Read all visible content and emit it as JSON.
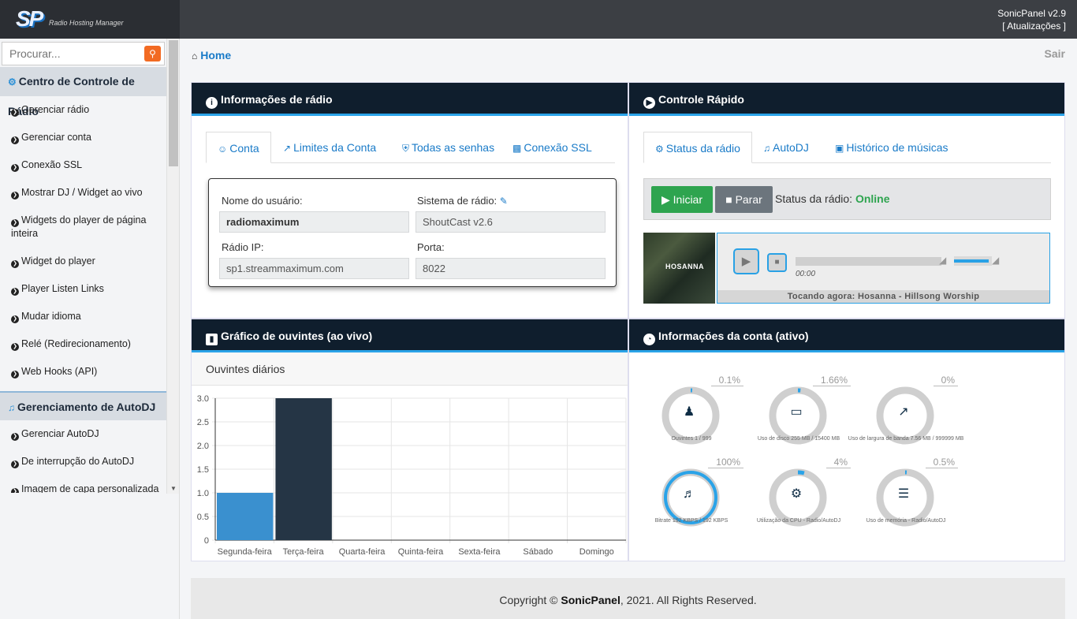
{
  "brand": {
    "logo": "SP",
    "subtitle": "Radio Hosting Manager"
  },
  "header": {
    "version": "SonicPanel v2.9",
    "updates": "[ Atualizações ]"
  },
  "search": {
    "placeholder": "Procurar..."
  },
  "sidebar": {
    "section1": "Centro de Controle de Rádio",
    "items1": [
      "Gerenciar rádio",
      "Gerenciar conta",
      "Conexão SSL",
      "Mostrar DJ / Widget ao vivo",
      "Widgets do player de página inteira",
      "Widget do player",
      "Player Listen Links",
      "Mudar idioma",
      "Relé (Redirecionamento)",
      "Web Hooks (API)"
    ],
    "section2": "Gerenciamento de AutoDJ",
    "items2": [
      "Gerenciar AutoDJ",
      "De interrupção do AutoDJ",
      "Imagem de capa personalizada"
    ]
  },
  "breadcrumb": {
    "home": "Home"
  },
  "logout": "Sair",
  "radio_info": {
    "title": "Informações de rádio",
    "tabs": [
      "Conta",
      "Limites da Conta",
      "Todas as senhas",
      "Conexão SSL"
    ],
    "username_label": "Nome do usuário:",
    "username": "radiomaximum",
    "system_label": "Sistema de rádio:",
    "system": "ShoutCast v2.6",
    "ip_label": "Rádio IP:",
    "ip": "sp1.streammaximum.com",
    "port_label": "Porta:",
    "port": "8022"
  },
  "quick_control": {
    "title": "Controle Rápido",
    "tabs": [
      "Status da rádio",
      "AutoDJ",
      "Histórico de músicas"
    ],
    "start": "Iniciar",
    "stop": "Parar",
    "status_label": "Status da rádio:",
    "status": "Online",
    "cover_text": "HOSANNA",
    "time": "00:00",
    "volume": 0.92,
    "now_playing": "Tocando agora: Hosanna - Hillsong Worship"
  },
  "listeners_chart": {
    "title": "Gráfico de ouvintes (ao vivo)",
    "subtitle": "Ouvintes diários"
  },
  "chart_data": {
    "type": "bar",
    "title": "Ouvintes diários",
    "categories": [
      "Segunda-feira",
      "Terça-feira",
      "Quarta-feira",
      "Quinta-feira",
      "Sexta-feira",
      "Sábado",
      "Domingo"
    ],
    "values": [
      1,
      3,
      0,
      0,
      0,
      0,
      0
    ],
    "ylim": [
      0,
      3
    ],
    "yticks": [
      "3.0",
      "2.5",
      "2.0",
      "1.5",
      "1.0",
      "0.5",
      "0"
    ],
    "grid": true,
    "colors": [
      "#3a90cf",
      "#253545",
      "#253545",
      "#253545",
      "#253545",
      "#253545",
      "#253545"
    ]
  },
  "account_info": {
    "title": "Informações da conta (ativo)",
    "gauges": [
      {
        "pct": "0.1%",
        "fraction": 0.001,
        "icon": "users-icon",
        "caption": "Ouvintes 1 / 999"
      },
      {
        "pct": "1.66%",
        "fraction": 0.0166,
        "icon": "hdd-icon",
        "caption": "Uso de disco 255 MB / 15400 MB"
      },
      {
        "pct": "0%",
        "fraction": 0,
        "icon": "chart-line-icon",
        "caption": "Uso de largura de banda 7.56 MB / 999999 MB"
      },
      {
        "pct": "100%",
        "fraction": 1,
        "icon": "volume-icon",
        "caption": "Bitrate 192 KBPS / 192 KBPS"
      },
      {
        "pct": "4%",
        "fraction": 0.04,
        "icon": "cog-icon",
        "caption": "Utilização da CPU - Radio/AutoDJ"
      },
      {
        "pct": "0.5%",
        "fraction": 0.005,
        "icon": "server-icon",
        "caption": "Uso de memória - Radio/AutoDJ"
      }
    ]
  },
  "footer": {
    "prefix": "Copyright ©",
    "brand": "SonicPanel",
    "suffix": ", 2021. All Rights Reserved."
  }
}
